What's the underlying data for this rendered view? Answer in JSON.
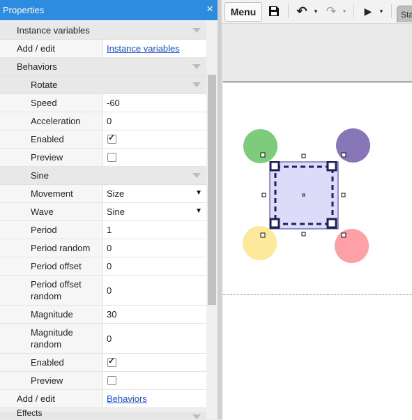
{
  "panel": {
    "title": "Properties",
    "close_glyph": "×",
    "instance_vars_header": "Instance variables",
    "instance_vars_add_label": "Add / edit",
    "instance_vars_link": "Instance variables",
    "behaviors_header": "Behaviors",
    "rotate": {
      "header": "Rotate",
      "speed_label": "Speed",
      "speed": "-60",
      "acceleration_label": "Acceleration",
      "acceleration": "0",
      "enabled_label": "Enabled",
      "enabled": true,
      "preview_label": "Preview",
      "preview": false
    },
    "sine": {
      "header": "Sine",
      "movement_label": "Movement",
      "movement": "Size",
      "wave_label": "Wave",
      "wave": "Sine",
      "period_label": "Period",
      "period": "1",
      "period_random_label": "Period random",
      "period_random": "0",
      "period_offset_label": "Period offset",
      "period_offset": "0",
      "period_offset_random_label": "Period offset random",
      "period_offset_random": "0",
      "magnitude_label": "Magnitude",
      "magnitude": "30",
      "magnitude_random_label": "Magnitude random",
      "magnitude_random": "0",
      "enabled_label": "Enabled",
      "enabled": true,
      "preview_label": "Preview",
      "preview": false
    },
    "behaviors_add_label": "Add / edit",
    "behaviors_link": "Behaviors",
    "effects_header": "Effects"
  },
  "toolbar": {
    "menu_label": "Menu",
    "save_icon": "save-icon",
    "undo_icon": "undo-icon",
    "redo_icon": "redo-icon",
    "play_icon": "play-icon",
    "dropdown_glyph": "▾",
    "tab_label": "Sta"
  },
  "layout": {
    "circle_colors": {
      "green": "#7ccc7c",
      "purple": "#8877b8",
      "yellow": "#fde99b",
      "red": "#fea0a6"
    },
    "selected_fill": "#dcdcfa",
    "selected_border": "#1e1e5a"
  }
}
